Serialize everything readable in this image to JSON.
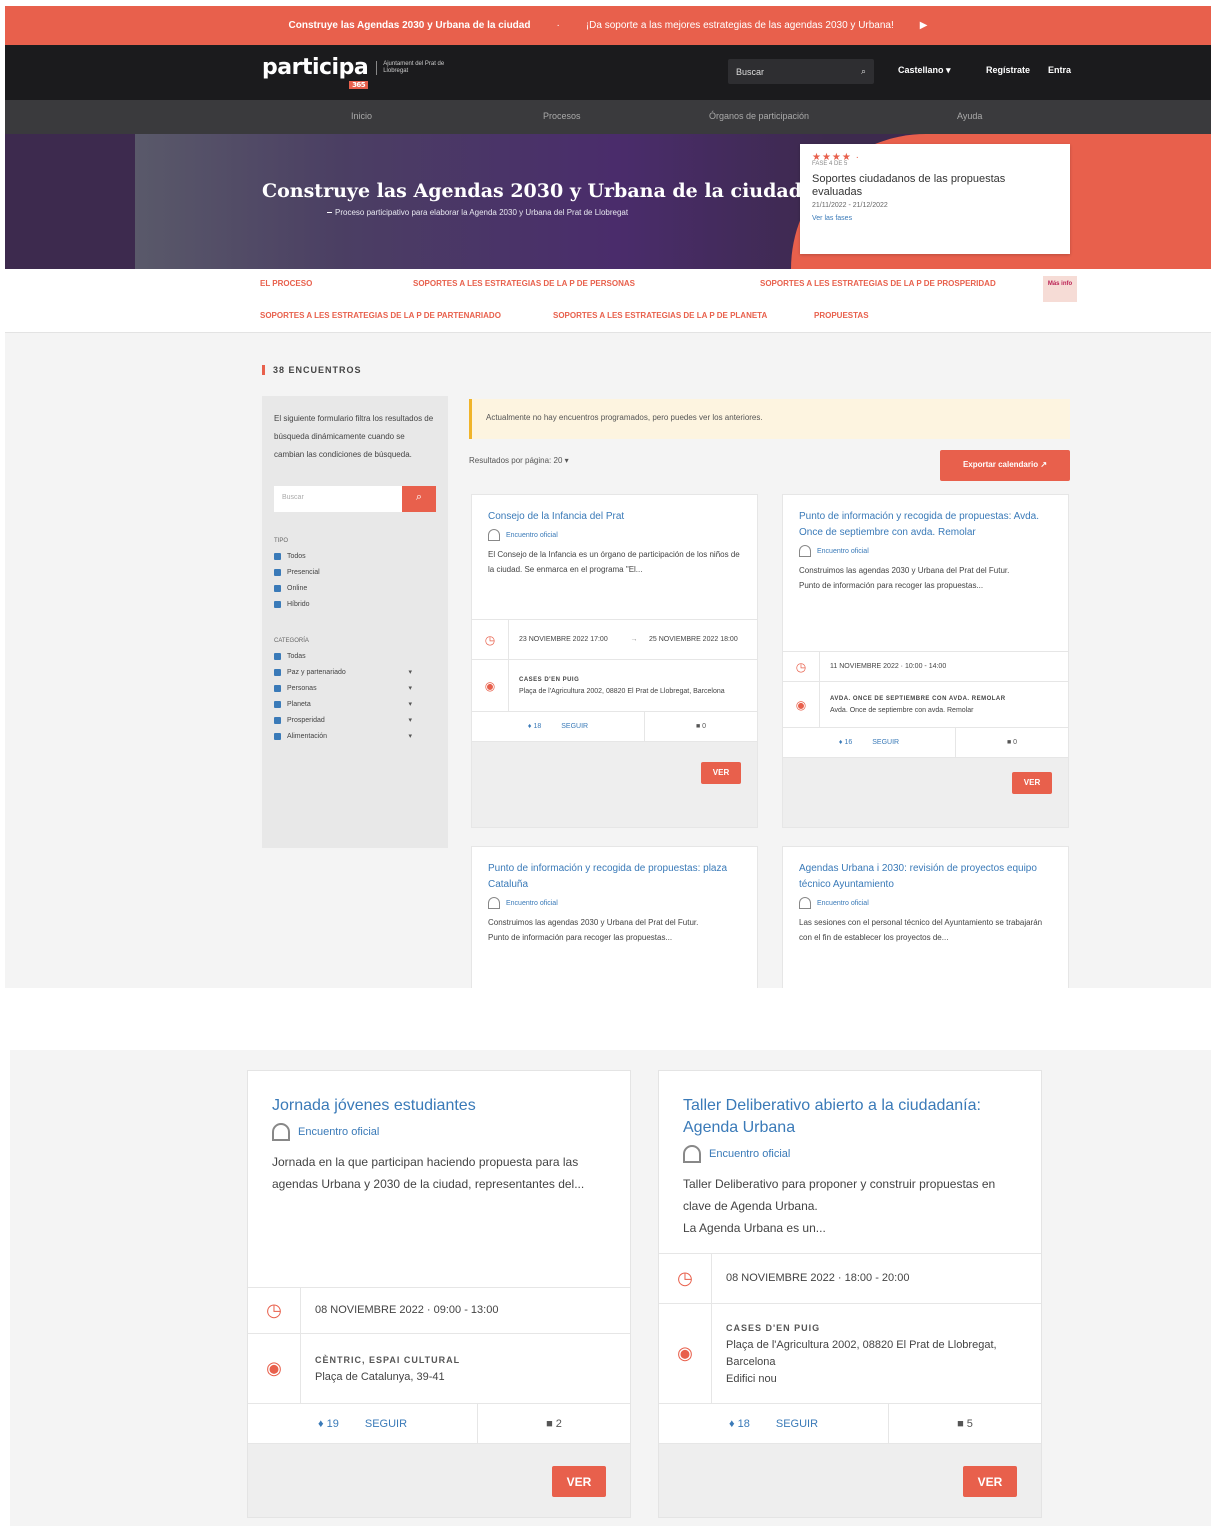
{
  "topbar": {
    "headline": "Construye las Agendas 2030 y Urbana de la ciudad",
    "sep": "·",
    "cta": "¡Da soporte a las mejores estrategias de las agendas 2030 y Urbana!",
    "arrow": "▶"
  },
  "header": {
    "logo_word": "participa",
    "logo_badge": "365",
    "logo_sub": "Ajuntament del Prat de Llobregat",
    "search_placeholder": "Buscar",
    "search_icon": "⌕",
    "language": "Castellano ▾",
    "register": "Regístrate",
    "login": "Entra"
  },
  "nav": {
    "items": [
      "Inicio",
      "Procesos",
      "Órganos de participación",
      "Ayuda"
    ]
  },
  "hero": {
    "title": "Construye las Agendas 2030 y Urbana de la ciudad",
    "subtitle": "Proceso participativo para elaborar la Agenda 2030 y Urbana del Prat de Llobregat",
    "phase_stars": "★★★★ ·",
    "phase_label": "FASE 4 DE 5",
    "phase_title": "Soportes ciudadanos de las propuestas evaluadas",
    "phase_dates": "21/11/2022 - 21/12/2022",
    "phase_link": "Ver las fases"
  },
  "subnav": {
    "items": [
      "EL PROCESO",
      "SOPORTES A LES ESTRATEGIAS DE LA P DE PERSONAS",
      "SOPORTES A LES ESTRATEGIAS DE LA P DE PROSPERIDAD",
      "SOPORTES A LES ESTRATEGIAS DE LA P DE PARTENARIADO",
      "SOPORTES A LES ESTRATEGIAS DE LA P DE PLANETA",
      "PROPUESTAS"
    ],
    "more": "Más info"
  },
  "content": {
    "section_title": "38 ENCUENTROS",
    "filters_note": "El siguiente formulario filtra los resultados de búsqueda dinámicamente cuando se cambian las condiciones de búsqueda.",
    "search_placeholder": "Buscar",
    "search_icon": "⌕",
    "type_label": "TIPO",
    "types": [
      "Todos",
      "Presencial",
      "Online",
      "Híbrido"
    ],
    "category_label": "CATEGORÍA",
    "categories": [
      "Todas",
      "Paz y partenariado",
      "Personas",
      "Planeta",
      "Prosperidad",
      "Alimentación"
    ],
    "chevron": "▾",
    "alert": "Actualmente no hay encuentros programados, pero puedes ver los anteriores.",
    "per_page": "Resultados por página:  20  ▾",
    "export": "Exportar calendario  ↗"
  },
  "cards": [
    {
      "title": "Consejo de la Infancia del Prat",
      "type": "Encuentro oficial",
      "desc": "El Consejo de la Infancia es un órgano de participación de los niños de la ciudad. Se enmarca en el programa \"El...",
      "date_start": "23 NOVIEMBRE 2022  17:00",
      "date_arrow": "→",
      "date_end": "25 NOVIEMBRE 2022  18:00",
      "place_caps": "CASES D'EN PUIG",
      "place": "Plaça de l'Agricultura 2002, 08820 El Prat de Llobregat, Barcelona",
      "endorse": "♦ 18",
      "follow": "SEGUIR",
      "comments": "■ 0",
      "btn": "VER",
      "clock_icon": "◷",
      "pin_icon": "◉"
    },
    {
      "title": "Punto de información y recogida de propuestas: Avda. Once de septiembre con avda. Remolar",
      "type": "Encuentro oficial",
      "desc": "Construimos las agendas 2030 y Urbana del Prat del Futur.\nPunto de información para recoger las propuestas...",
      "date_start": "11 NOVIEMBRE 2022  ·  10:00 - 14:00",
      "place_caps": "AVDA. ONCE DE SEPTIEMBRE CON AVDA. REMOLAR",
      "place": "Avda. Once de septiembre con avda. Remolar",
      "endorse": "♦ 16",
      "follow": "SEGUIR",
      "comments": "■ 0",
      "btn": "VER",
      "clock_icon": "◷",
      "pin_icon": "◉"
    },
    {
      "title": "Punto de información y recogida de propuestas: plaza Cataluña",
      "type": "Encuentro oficial",
      "desc": "Construimos las agendas 2030 y Urbana del Prat del Futur.\nPunto de información para recoger las propuestas..."
    },
    {
      "title": "Agendas Urbana i 2030: revisión de proyectos equipo técnico Ayuntamiento",
      "type": "Encuentro oficial",
      "desc": "Las sesiones con el personal técnico del Ayuntamiento se trabajarán con el fin de establecer los proyectos de..."
    }
  ],
  "bigcards": [
    {
      "title": "Jornada jóvenes estudiantes",
      "type": "Encuentro oficial",
      "desc": "Jornada en la que participan haciendo propuesta para las agendas Urbana y 2030 de la ciudad, representantes del...",
      "date": "08 NOVIEMBRE 2022  ·  09:00 - 13:00",
      "place_caps": "CÈNTRIC, ESPAI CULTURAL",
      "place": "Plaça de Catalunya, 39-41",
      "place2": "",
      "endorse": "♦ 19",
      "follow": "SEGUIR",
      "comments": "■ 2",
      "btn": "VER",
      "clock_icon": "◷",
      "pin_icon": "◉"
    },
    {
      "title": "Taller Deliberativo abierto a la ciudadanía: Agenda Urbana",
      "type": "Encuentro oficial",
      "desc": "Taller Deliberativo para proponer y construir propuestas en clave de Agenda Urbana.\nLa Agenda Urbana es un...",
      "date": "08 NOVIEMBRE 2022  ·  18:00 - 20:00",
      "place_caps": "CASES D'EN PUIG",
      "place": "Plaça de l'Agricultura 2002, 08820 El Prat de Llobregat, Barcelona",
      "place2": "Edifici nou",
      "endorse": "♦ 18",
      "follow": "SEGUIR",
      "comments": "■ 5",
      "btn": "VER",
      "clock_icon": "◷",
      "pin_icon": "◉"
    }
  ],
  "colors": {
    "accent": "#e8604c",
    "link": "#3a7ab8",
    "dark": "#1b1b1d"
  }
}
